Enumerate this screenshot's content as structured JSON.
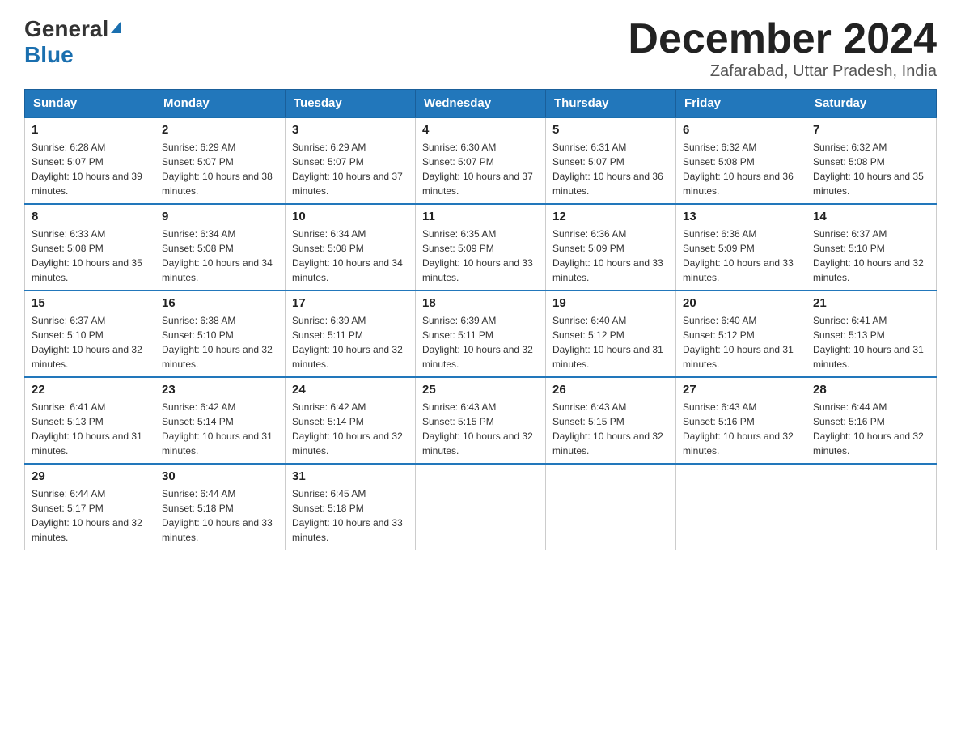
{
  "header": {
    "logo_line1": "General",
    "logo_line2": "Blue",
    "month_title": "December 2024",
    "location": "Zafarabad, Uttar Pradesh, India"
  },
  "days_of_week": [
    "Sunday",
    "Monday",
    "Tuesday",
    "Wednesday",
    "Thursday",
    "Friday",
    "Saturday"
  ],
  "weeks": [
    [
      {
        "day": "1",
        "sunrise": "6:28 AM",
        "sunset": "5:07 PM",
        "daylight": "10 hours and 39 minutes."
      },
      {
        "day": "2",
        "sunrise": "6:29 AM",
        "sunset": "5:07 PM",
        "daylight": "10 hours and 38 minutes."
      },
      {
        "day": "3",
        "sunrise": "6:29 AM",
        "sunset": "5:07 PM",
        "daylight": "10 hours and 37 minutes."
      },
      {
        "day": "4",
        "sunrise": "6:30 AM",
        "sunset": "5:07 PM",
        "daylight": "10 hours and 37 minutes."
      },
      {
        "day": "5",
        "sunrise": "6:31 AM",
        "sunset": "5:07 PM",
        "daylight": "10 hours and 36 minutes."
      },
      {
        "day": "6",
        "sunrise": "6:32 AM",
        "sunset": "5:08 PM",
        "daylight": "10 hours and 36 minutes."
      },
      {
        "day": "7",
        "sunrise": "6:32 AM",
        "sunset": "5:08 PM",
        "daylight": "10 hours and 35 minutes."
      }
    ],
    [
      {
        "day": "8",
        "sunrise": "6:33 AM",
        "sunset": "5:08 PM",
        "daylight": "10 hours and 35 minutes."
      },
      {
        "day": "9",
        "sunrise": "6:34 AM",
        "sunset": "5:08 PM",
        "daylight": "10 hours and 34 minutes."
      },
      {
        "day": "10",
        "sunrise": "6:34 AM",
        "sunset": "5:08 PM",
        "daylight": "10 hours and 34 minutes."
      },
      {
        "day": "11",
        "sunrise": "6:35 AM",
        "sunset": "5:09 PM",
        "daylight": "10 hours and 33 minutes."
      },
      {
        "day": "12",
        "sunrise": "6:36 AM",
        "sunset": "5:09 PM",
        "daylight": "10 hours and 33 minutes."
      },
      {
        "day": "13",
        "sunrise": "6:36 AM",
        "sunset": "5:09 PM",
        "daylight": "10 hours and 33 minutes."
      },
      {
        "day": "14",
        "sunrise": "6:37 AM",
        "sunset": "5:10 PM",
        "daylight": "10 hours and 32 minutes."
      }
    ],
    [
      {
        "day": "15",
        "sunrise": "6:37 AM",
        "sunset": "5:10 PM",
        "daylight": "10 hours and 32 minutes."
      },
      {
        "day": "16",
        "sunrise": "6:38 AM",
        "sunset": "5:10 PM",
        "daylight": "10 hours and 32 minutes."
      },
      {
        "day": "17",
        "sunrise": "6:39 AM",
        "sunset": "5:11 PM",
        "daylight": "10 hours and 32 minutes."
      },
      {
        "day": "18",
        "sunrise": "6:39 AM",
        "sunset": "5:11 PM",
        "daylight": "10 hours and 32 minutes."
      },
      {
        "day": "19",
        "sunrise": "6:40 AM",
        "sunset": "5:12 PM",
        "daylight": "10 hours and 31 minutes."
      },
      {
        "day": "20",
        "sunrise": "6:40 AM",
        "sunset": "5:12 PM",
        "daylight": "10 hours and 31 minutes."
      },
      {
        "day": "21",
        "sunrise": "6:41 AM",
        "sunset": "5:13 PM",
        "daylight": "10 hours and 31 minutes."
      }
    ],
    [
      {
        "day": "22",
        "sunrise": "6:41 AM",
        "sunset": "5:13 PM",
        "daylight": "10 hours and 31 minutes."
      },
      {
        "day": "23",
        "sunrise": "6:42 AM",
        "sunset": "5:14 PM",
        "daylight": "10 hours and 31 minutes."
      },
      {
        "day": "24",
        "sunrise": "6:42 AM",
        "sunset": "5:14 PM",
        "daylight": "10 hours and 32 minutes."
      },
      {
        "day": "25",
        "sunrise": "6:43 AM",
        "sunset": "5:15 PM",
        "daylight": "10 hours and 32 minutes."
      },
      {
        "day": "26",
        "sunrise": "6:43 AM",
        "sunset": "5:15 PM",
        "daylight": "10 hours and 32 minutes."
      },
      {
        "day": "27",
        "sunrise": "6:43 AM",
        "sunset": "5:16 PM",
        "daylight": "10 hours and 32 minutes."
      },
      {
        "day": "28",
        "sunrise": "6:44 AM",
        "sunset": "5:16 PM",
        "daylight": "10 hours and 32 minutes."
      }
    ],
    [
      {
        "day": "29",
        "sunrise": "6:44 AM",
        "sunset": "5:17 PM",
        "daylight": "10 hours and 32 minutes."
      },
      {
        "day": "30",
        "sunrise": "6:44 AM",
        "sunset": "5:18 PM",
        "daylight": "10 hours and 33 minutes."
      },
      {
        "day": "31",
        "sunrise": "6:45 AM",
        "sunset": "5:18 PM",
        "daylight": "10 hours and 33 minutes."
      },
      null,
      null,
      null,
      null
    ]
  ]
}
